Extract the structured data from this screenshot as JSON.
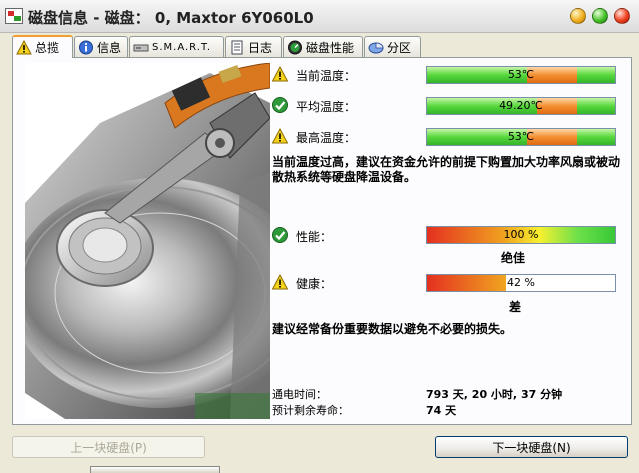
{
  "window": {
    "title": "磁盘信息 - 磁盘： 0, Maxtor 6Y060L0"
  },
  "tabs": [
    {
      "label": "总揽",
      "icon": "warning-icon",
      "active": true
    },
    {
      "label": "信息",
      "icon": "info-icon",
      "active": false
    },
    {
      "label": "S.M.A.R.T.",
      "icon": "drive-icon",
      "active": false
    },
    {
      "label": "日志",
      "icon": "log-icon",
      "active": false
    },
    {
      "label": "磁盘性能",
      "icon": "performance-icon",
      "active": false
    },
    {
      "label": "分区",
      "icon": "partition-icon",
      "active": false
    }
  ],
  "temperature": {
    "current": {
      "label": "当前温度：",
      "value": "53℃",
      "status": "warning"
    },
    "average": {
      "label": "平均温度：",
      "value": "49.20℃",
      "status": "ok"
    },
    "max": {
      "label": "最高温度：",
      "value": "53℃",
      "status": "warning"
    },
    "advice": "当前温度过高，建议在资金允许的前提下购置加大功率风扇或被动散热系统等硬盘降温设备。"
  },
  "performance": {
    "label": "性能：",
    "value": "100 %",
    "percent": 100,
    "grade": "绝佳",
    "status": "ok"
  },
  "health": {
    "label": "健康：",
    "value": "42 %",
    "percent": 42,
    "grade": "差",
    "status": "warning"
  },
  "health_advice": "建议经常备份重要数据以避免不必要的损失。",
  "footer": {
    "power_on_label": "通电时间：",
    "power_on_value": "793 天, 20 小时, 37 分钟",
    "life_label": "预计剩余寿命：",
    "life_value": "74 天"
  },
  "buttons": {
    "prev": "上一块硬盘(P)",
    "next": "下一块硬盘(N)"
  },
  "colors": {
    "accent": "#f0a030",
    "ok_green": "#2e9a3a",
    "warning_yellow": "#f5d21a"
  }
}
